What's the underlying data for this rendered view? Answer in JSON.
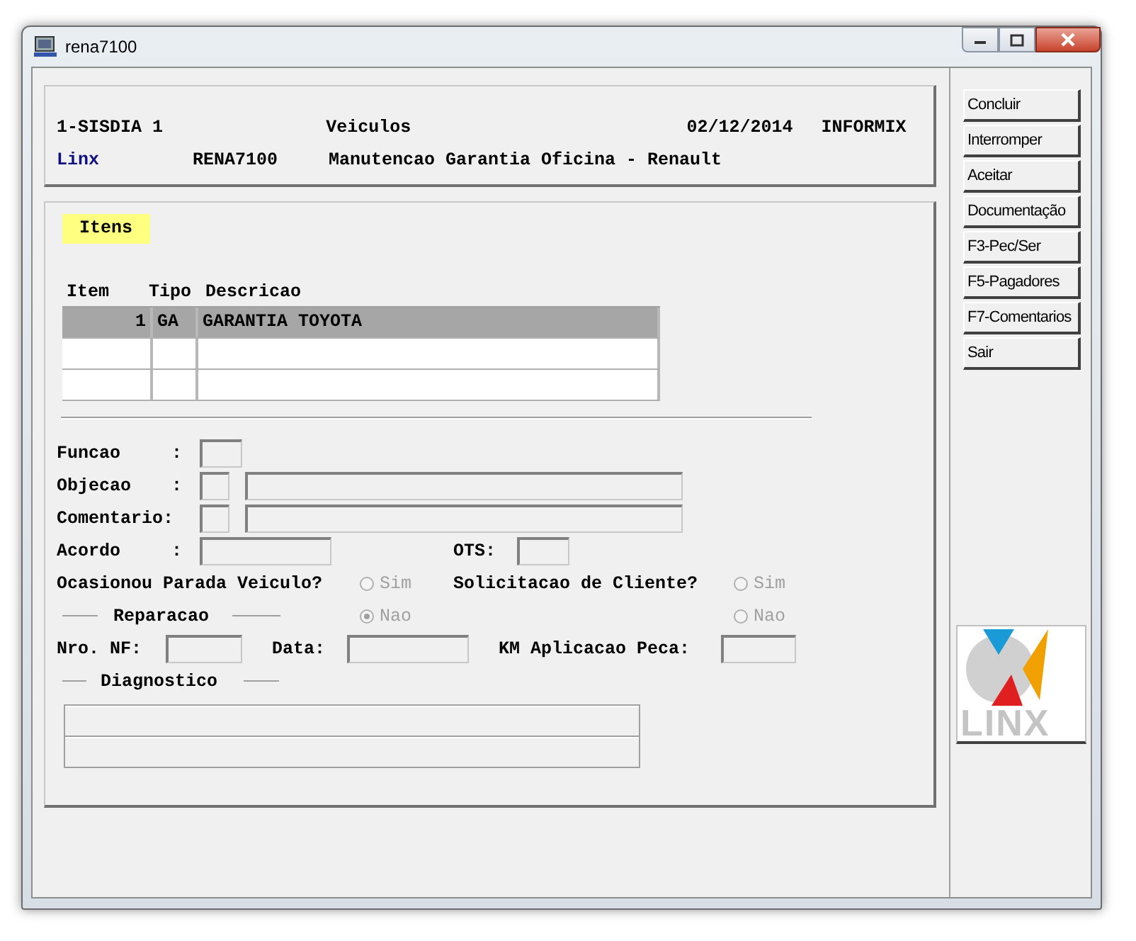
{
  "window": {
    "title": "rena7100"
  },
  "header": {
    "line1": [
      "1-SISDIA 1",
      "Veiculos",
      "02/12/2014",
      "INFORMIX"
    ],
    "line2": [
      "Linx",
      "RENA7100",
      "Manutencao Garantia Oficina - Renault"
    ]
  },
  "section_tag": "Itens",
  "table": {
    "columns": [
      "Item",
      "Tipo",
      "Descricao"
    ],
    "rows": [
      {
        "cells": [
          "1",
          "GA",
          "GARANTIA TOYOTA"
        ],
        "selected": true
      },
      {
        "cells": [
          "",
          "",
          ""
        ],
        "selected": false
      },
      {
        "cells": [
          "",
          "",
          ""
        ],
        "selected": false
      }
    ]
  },
  "form": {
    "funcao": {
      "label": "Funcao",
      "colon": ":"
    },
    "objecao": {
      "label": "Objecao",
      "colon": ":"
    },
    "comentario": {
      "label": "Comentario:"
    },
    "acordo": {
      "label": "Acordo",
      "colon": ":"
    },
    "ots": {
      "label": "OTS:"
    },
    "parada": {
      "label": "Ocasionou Parada Veiculo?",
      "options": [
        {
          "label": "Sim",
          "selected": false
        },
        {
          "label": "Nao",
          "selected": true
        }
      ]
    },
    "solicitacao": {
      "label": "Solicitacao de Cliente?",
      "options": [
        {
          "label": "Sim",
          "selected": false
        },
        {
          "label": "Nao",
          "selected": false
        }
      ]
    },
    "reparacao": {
      "title": "Reparacao",
      "nro_nf": "Nro. NF:",
      "data": "Data:",
      "km": "KM Aplicacao Peca:"
    },
    "diagnostico": {
      "title": "Diagnostico"
    }
  },
  "buttons": [
    "Concluir",
    "Interromper",
    "Aceitar",
    "Documentação",
    "F3-Pec/Ser",
    "F5-Pagadores",
    "F7-Comentarios",
    "Sair"
  ],
  "logo": {
    "text": "LINX"
  }
}
